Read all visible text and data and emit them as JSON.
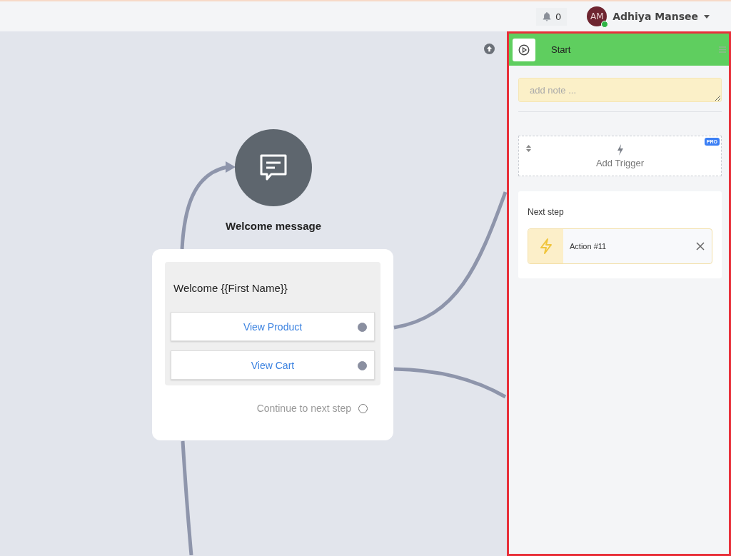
{
  "topbar": {
    "notifications": "0",
    "user": {
      "initials": "AM",
      "name": "Adhiya Mansee",
      "online": true
    }
  },
  "canvas": {
    "node": {
      "title": "Welcome message",
      "message": "Welcome {{First Name}}",
      "buttons": [
        {
          "label": "View Product",
          "connected": true
        },
        {
          "label": "View Cart",
          "connected": true
        }
      ],
      "continue": {
        "label": "Continue to next step",
        "connected": false
      }
    }
  },
  "panel": {
    "title": "Start",
    "note": {
      "placeholder": "add note ..."
    },
    "trigger": {
      "label": "Add Trigger",
      "badge": "PRO"
    },
    "next_step": {
      "title": "Next step",
      "items": [
        {
          "label": "Action #11"
        }
      ]
    }
  }
}
